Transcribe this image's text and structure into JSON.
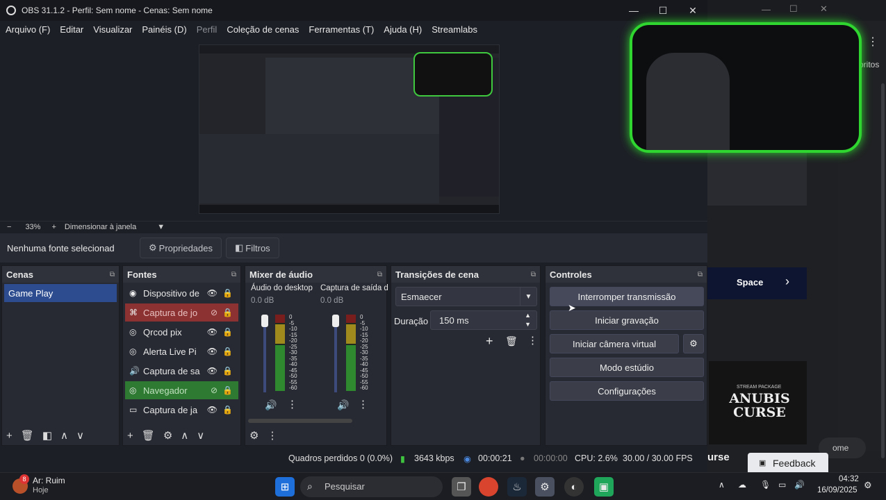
{
  "window": {
    "title": "OBS 31.1.2 - Perfil: Sem nome - Cenas: Sem nome",
    "minimize": "—",
    "maximize": "☐",
    "close": "✕"
  },
  "menu": [
    "Arquivo (F)",
    "Editar",
    "Visualizar",
    "Painéis (D)",
    "Perfil",
    "Coleção de cenas",
    "Ferramentas (T)",
    "Ajuda (H)",
    "Streamlabs"
  ],
  "zoom": {
    "minus": "−",
    "level": "33%",
    "plus": "+",
    "fit": "Dimensionar à janela"
  },
  "source_bar": {
    "label": "Nenhuma fonte selecionad",
    "properties": "Propriedades",
    "filters": "Filtros"
  },
  "scenes": {
    "title": "Cenas",
    "items": [
      "Game Play"
    ]
  },
  "sources": {
    "title": "Fontes",
    "items": [
      {
        "name": "Dispositivo de",
        "icon": "camera-icon"
      },
      {
        "name": "Captura de jo",
        "icon": "gamepad-icon"
      },
      {
        "name": "Qrcod pix",
        "icon": "globe-icon"
      },
      {
        "name": "Alerta Live Pi",
        "icon": "globe-icon"
      },
      {
        "name": "Captura de sa",
        "icon": "speaker-icon"
      },
      {
        "name": "Navegador",
        "icon": "globe-icon"
      },
      {
        "name": "Captura de ja",
        "icon": "window-icon"
      }
    ]
  },
  "mixer": {
    "title": "Mixer de áudio",
    "channels": [
      {
        "name": "Áudio do desktop",
        "db": "0.0 dB"
      },
      {
        "name": "Captura de saída d",
        "db": "0.0 dB"
      }
    ],
    "scale": [
      "0",
      "-5",
      "-10",
      "-15",
      "-20",
      "-25",
      "-30",
      "-35",
      "-40",
      "-45",
      "-50",
      "-55",
      "-60"
    ]
  },
  "transitions": {
    "title": "Transições de cena",
    "selected": "Esmaecer",
    "duration_label": "Duração",
    "duration": "150 ms"
  },
  "controls": {
    "title": "Controles",
    "stop_stream": "Interromper transmissão",
    "start_record": "Iniciar gravação",
    "virtual_cam": "Iniciar câmera virtual",
    "studio_mode": "Modo estúdio",
    "settings": "Configurações"
  },
  "status": {
    "dropped": "Quadros perdidos 0 (0.0%)",
    "bitrate": "3643 kbps",
    "stream_time": "00:00:21",
    "record_time": "00:00:00",
    "cpu": "CPU: 2.6%",
    "fps": "30.00 / 30.00 FPS"
  },
  "background_window": {
    "text_fritos": "oritos",
    "space_label": "Space",
    "anubis_title": "ANUBIS CURSE",
    "anubis_sub": "STREAM PACKAGE",
    "curse_label": "urse",
    "home_label": "ome",
    "feedback": "Feedback"
  },
  "taskbar": {
    "weather": "Ar: Ruim",
    "weather_sub": "Hoje",
    "weather_badge": "8",
    "search": "Pesquisar",
    "time": "04:32",
    "date": "16/09/2025"
  }
}
